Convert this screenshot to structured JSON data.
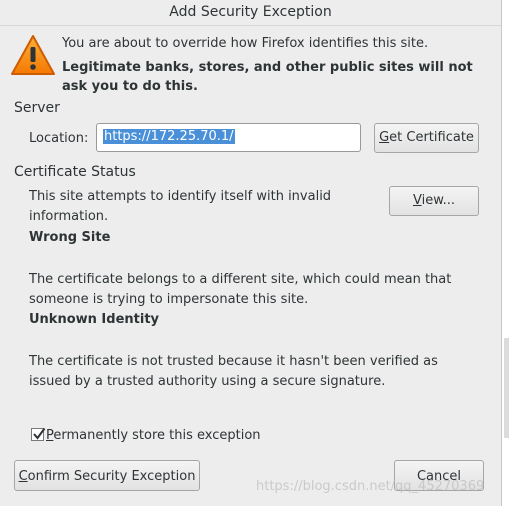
{
  "dialog": {
    "title": "Add Security Exception"
  },
  "warning": {
    "icon": "warning-triangle-icon",
    "message": "You are about to override how Firefox identifies this site.",
    "bold_message": "Legitimate banks, stores, and other public sites will not ask you to do this."
  },
  "server": {
    "section_label": "Server",
    "location_label": "Location:",
    "location_value": "https://172.25.70.1/",
    "get_certificate_first": "G",
    "get_certificate_rest": "et Certificate"
  },
  "certificate_status": {
    "section_label": "Certificate Status",
    "summary": "This site attempts to identify itself with invalid information.",
    "view_first": "V",
    "view_rest": "iew...",
    "wrong_site_title": "Wrong Site",
    "wrong_site_desc": "The certificate belongs to a different site, which could mean that someone is trying to impersonate this site.",
    "unknown_identity_title": "Unknown Identity",
    "unknown_identity_desc": "The certificate is not trusted because it hasn't been verified as issued by a trusted authority using a secure signature."
  },
  "permanent": {
    "checked": true,
    "label_first": "P",
    "label_rest": "ermanently store this exception"
  },
  "actions": {
    "confirm_first": "C",
    "confirm_rest": "onfirm Security Exception",
    "cancel": "Cancel"
  },
  "watermark": "https://blog.csdn.net/qq_45270369",
  "colors": {
    "selection": "#4a90d9",
    "warning_orange": "#f57900",
    "background": "#ededed"
  }
}
